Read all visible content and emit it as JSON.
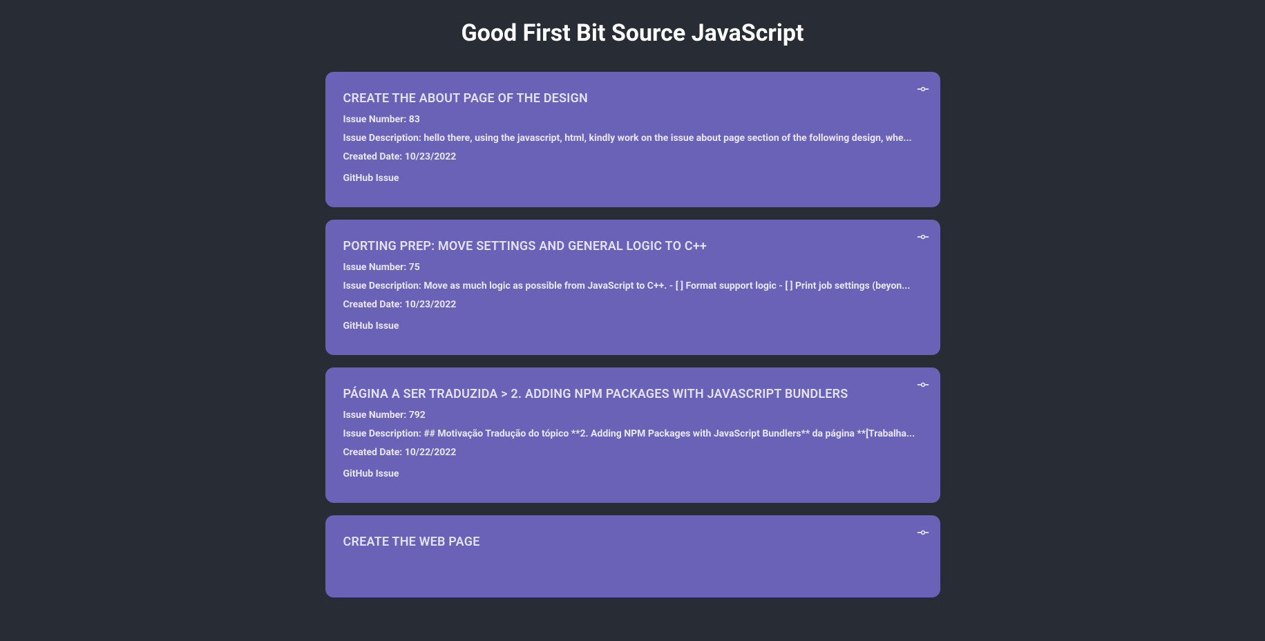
{
  "page_title": "Good First Bit Source JavaScript",
  "labels": {
    "issue_number_prefix": "Issue Number: ",
    "issue_description_prefix": "Issue Description: ",
    "created_date_prefix": "Created Date: ",
    "github_link_text": "GitHub Issue"
  },
  "issues": [
    {
      "title": "CREATE THE ABOUT PAGE OF THE DESIGN",
      "number": "83",
      "description": "hello there, using the javascript, html, kindly work on the issue about page section of the following design, whe...",
      "created": "10/23/2022"
    },
    {
      "title": "PORTING PREP: MOVE SETTINGS AND GENERAL LOGIC TO C++",
      "number": "75",
      "description": "Move as much logic as possible from JavaScript to C++. - [ ] Format support logic - [ ] Print job settings (beyon...",
      "created": "10/23/2022"
    },
    {
      "title": "PÁGINA A SER TRADUZIDA > 2. ADDING NPM PACKAGES WITH JAVASCRIPT BUNDLERS",
      "number": "792",
      "description": "## Motivação Tradução do tópico **2. Adding NPM Packages with JavaScript Bundlers** da página **[Trabalha...",
      "created": "10/22/2022"
    },
    {
      "title": "CREATE THE WEB PAGE",
      "number": "",
      "description": "",
      "created": ""
    }
  ]
}
